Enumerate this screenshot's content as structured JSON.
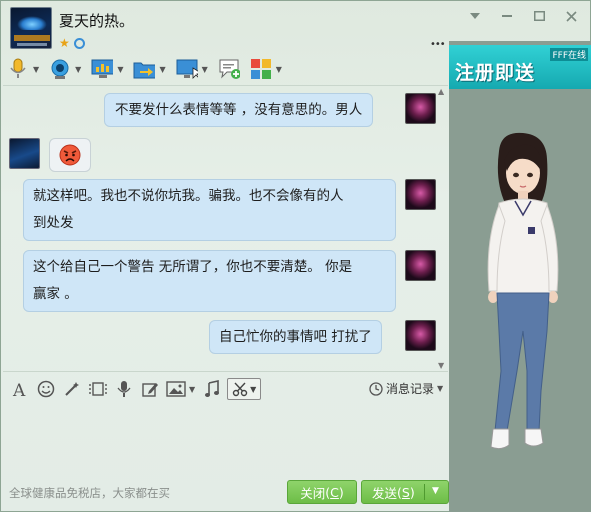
{
  "window": {
    "contact_name": "夏天的热。",
    "controls": [
      "minimize-down",
      "minimize",
      "maximize",
      "close"
    ]
  },
  "toolbar": {
    "items": [
      {
        "name": "voice-call-icon",
        "has_dropdown": true
      },
      {
        "name": "video-call-icon",
        "has_dropdown": true
      },
      {
        "name": "remote-desktop-icon",
        "has_dropdown": true
      },
      {
        "name": "send-file-icon",
        "has_dropdown": true
      },
      {
        "name": "screen-share-icon",
        "has_dropdown": true
      },
      {
        "name": "create-discussion-icon",
        "has_dropdown": false
      },
      {
        "name": "apps-icon",
        "has_dropdown": true
      }
    ]
  },
  "messages": [
    {
      "side": "right",
      "text": "不要发什么表情等等 ，没有意思的。男人"
    },
    {
      "side": "left",
      "type": "emoji",
      "emoji": "angry-face"
    },
    {
      "side": "right",
      "lines": [
        "就这样吧。我也不说你坑我。骗我。也不会像有的人",
        "到处发"
      ]
    },
    {
      "side": "right",
      "lines": [
        "这个给自己一个警告 无所谓了，你也不要清楚。 你是",
        "赢家 。"
      ]
    },
    {
      "side": "right",
      "text": "自己忙你的事情吧 打扰了"
    }
  ],
  "input_toolbar": {
    "history_label": "消息记录"
  },
  "footer": {
    "ad_text": "全球健康品免税店，大家都在买",
    "close_label": "关闭",
    "close_key": "C",
    "send_label": "发送",
    "send_key": "S"
  },
  "side_ad": {
    "banner_text": "注册即送",
    "banner_small": "FFF在线"
  },
  "colors": {
    "bubble": "#cfe6f7",
    "button_green": "#6dbd47",
    "ad_banner": "#15a9b0"
  }
}
